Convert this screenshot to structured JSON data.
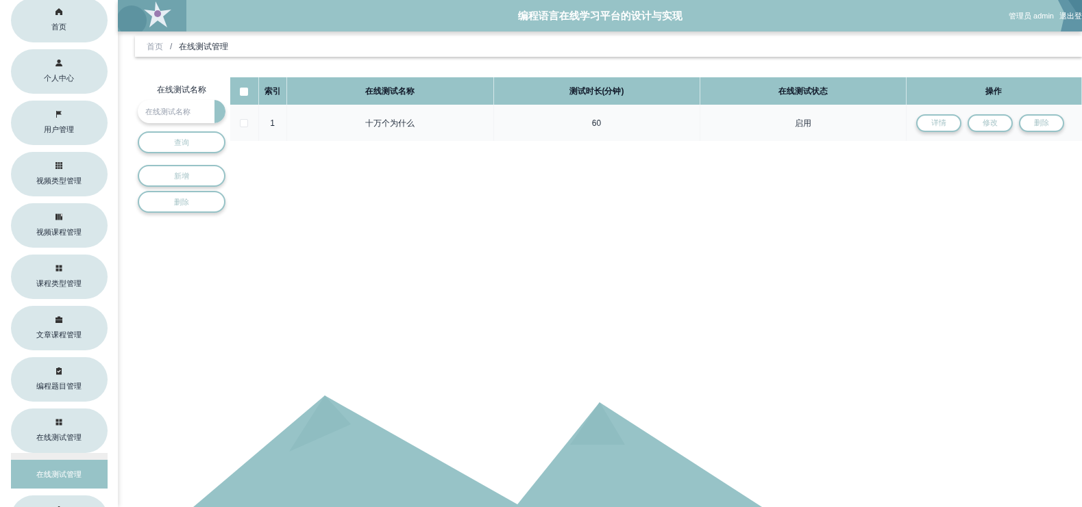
{
  "sidebar": {
    "items": [
      {
        "label": "首页",
        "selected": false
      },
      {
        "label": "个人中心",
        "selected": false
      },
      {
        "label": "用户管理",
        "selected": false
      },
      {
        "label": "视频类型管理",
        "selected": false
      },
      {
        "label": "视频课程管理",
        "selected": false
      },
      {
        "label": "课程类型管理",
        "selected": false
      },
      {
        "label": "文章课程管理",
        "selected": false
      },
      {
        "label": "编程题目管理",
        "selected": false
      },
      {
        "label": "在线测试管理",
        "selected": false,
        "expanded": true,
        "children": [
          {
            "label": "在线测试管理",
            "selected": true
          }
        ]
      }
    ]
  },
  "header": {
    "title": "编程语言在线学习平台的设计与实现",
    "user": "管理员 admin",
    "logout": "退出登"
  },
  "breadcrumb": [
    "首页",
    "在线测试管理"
  ],
  "breadcrumb_separator": "/",
  "search": {
    "label": "在线测试名称",
    "placeholder": "在线测试名称",
    "buttons": [
      "查询",
      "新增",
      "删除"
    ]
  },
  "table": {
    "columns": [
      "索引",
      "在线测试名称",
      "测试时长(分钟)",
      "在线测试状态",
      "操作"
    ],
    "select_all": false,
    "rows": [
      {
        "checked": false,
        "cells": [
          "1",
          "十万个为什么",
          "60",
          "启用"
        ],
        "actions": [
          "详情",
          "修改",
          "删除"
        ]
      }
    ]
  }
}
